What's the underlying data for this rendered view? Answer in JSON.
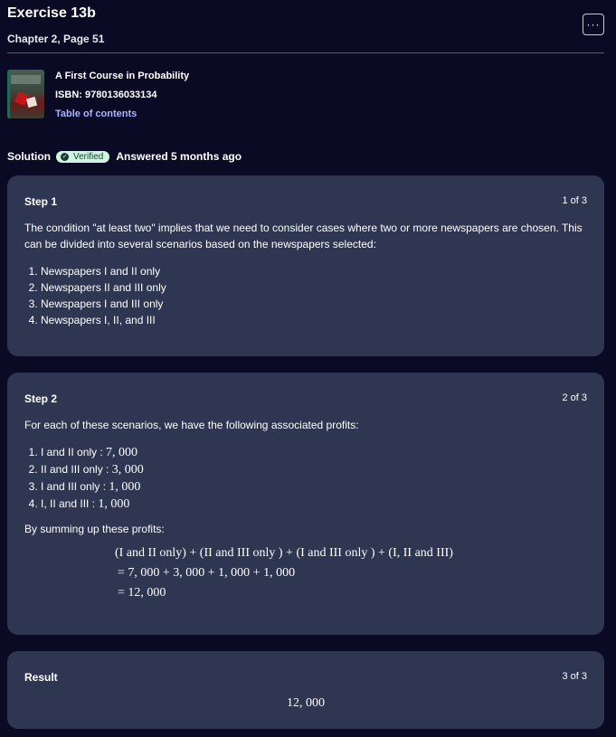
{
  "header": {
    "title": "Exercise 13b",
    "subtitle": "Chapter 2, Page 51",
    "more_label": "···"
  },
  "book": {
    "title": "A First Course in Probability",
    "isbn": "ISBN: 9780136033134",
    "toc": "Table of contents"
  },
  "solution": {
    "label": "Solution",
    "badge": "Verified",
    "answered": "Answered 5 months ago"
  },
  "steps": [
    {
      "title": "Step 1",
      "count": "1 of 3",
      "intro": "The condition \"at least two\" implies that we need to consider cases where two or more newspapers are chosen. This can be divided into several scenarios based on the newspapers selected:",
      "items": [
        "Newspapers I and II only",
        "Newspapers II and III only",
        "Newspapers I and III only",
        "Newspapers I, II, and III"
      ]
    },
    {
      "title": "Step 2",
      "count": "2 of 3",
      "intro": "For each of these scenarios, we have the following associated profits:",
      "items": [
        {
          "label": "I and II only : ",
          "value": "7, 000"
        },
        {
          "label": "II and III only : ",
          "value": "3, 000"
        },
        {
          "label": "I and III only : ",
          "value": "1, 000"
        },
        {
          "label": "I, II and III : ",
          "value": "1, 000"
        }
      ],
      "sum_intro": "By summing up these profits:",
      "eq_lines": [
        "(I and II only) + (II and III only ) + (I and III only ) + (I, II and III)",
        "= 7, 000 + 3, 000 + 1, 000 + 1, 000",
        "= 12, 000"
      ]
    },
    {
      "title": "Result",
      "count": "3 of 3",
      "value": "12, 000"
    }
  ]
}
